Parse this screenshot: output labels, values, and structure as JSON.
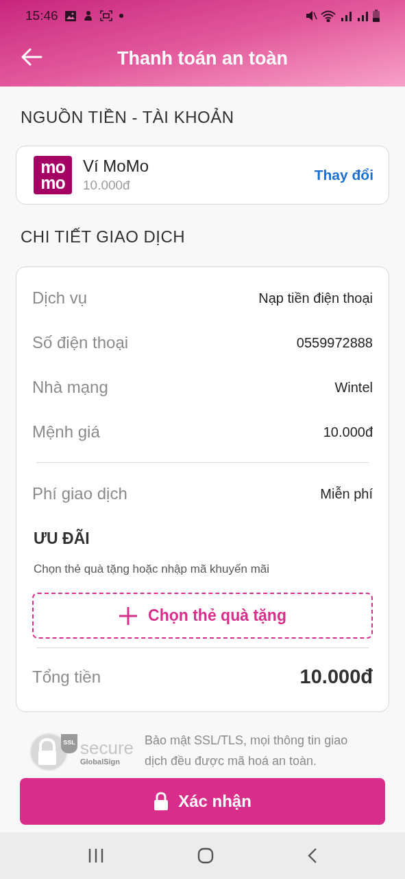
{
  "status_bar": {
    "time": "15:46"
  },
  "header": {
    "title": "Thanh toán an toàn"
  },
  "source": {
    "heading": "NGUỒN TIỀN - TÀI KHOẢN",
    "logo_lines": [
      "mo",
      "mo"
    ],
    "wallet_name": "Ví MoMo",
    "balance": "10.000đ",
    "change_link": "Thay đổi"
  },
  "details": {
    "heading": "CHI TIẾT GIAO DỊCH",
    "rows": [
      {
        "label": "Dịch vụ",
        "value": "Nạp tiền điện thoại"
      },
      {
        "label": "Số điện thoại",
        "value": "0559972888"
      },
      {
        "label": "Nhà mạng",
        "value": "Wintel"
      },
      {
        "label": "Mệnh giá",
        "value": "10.000đ"
      }
    ],
    "fee": {
      "label": "Phí giao dịch",
      "value": "Miễn phí"
    },
    "promo": {
      "title": "ƯU ĐÃI",
      "hint": "Chọn thẻ quà tặng hoặc nhập mã khuyến mãi",
      "button": "Chọn thẻ quà tặng"
    },
    "total": {
      "label": "Tổng tiền",
      "value": "10.000đ"
    }
  },
  "security": {
    "badge_word": "secure",
    "badge_brand": "GlobalSign",
    "badge_ssl": "SSL",
    "note": "Bảo mật SSL/TLS, mọi thông tin giao dịch đều được mã hoá an toàn."
  },
  "confirm_button": "Xác nhận"
}
